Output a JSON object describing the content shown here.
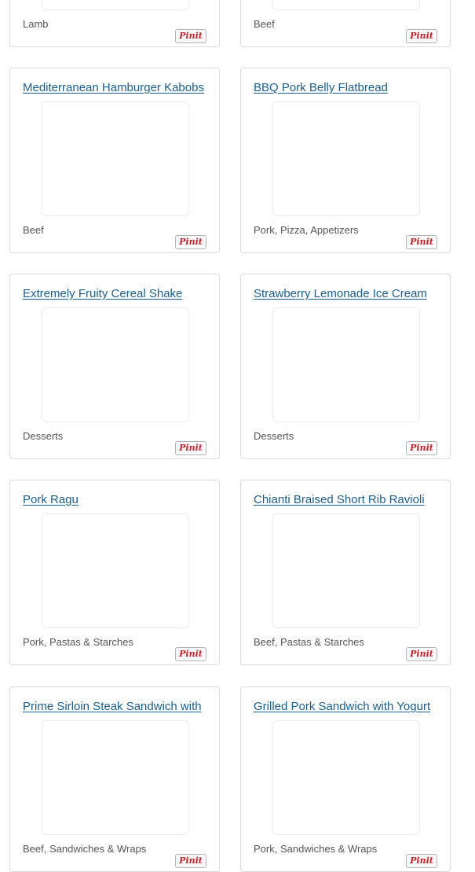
{
  "colors": {
    "title_link": "#1a5e8e",
    "category_text": "#555555",
    "pinit_red": "#cb2027",
    "card_border": "#dcdcdc"
  },
  "pin_label": "Pinit",
  "cards": [
    {
      "title": "",
      "category": "Lamb"
    },
    {
      "title": "",
      "category": "Beef"
    },
    {
      "title": "Mediterranean Hamburger Kabobs",
      "category": "Beef"
    },
    {
      "title": "BBQ Pork Belly Flatbread",
      "category": "Pork, Pizza, Appetizers"
    },
    {
      "title": "Extremely Fruity Cereal Shake",
      "category": "Desserts"
    },
    {
      "title": "Strawberry Lemonade Ice Cream",
      "category": "Desserts"
    },
    {
      "title": "Pork Ragu",
      "category": "Pork, Pastas & Starches"
    },
    {
      "title": "Chianti Braised Short Rib Ravioli",
      "category": "Beef, Pastas & Starches"
    },
    {
      "title": "Prime Sirloin Steak Sandwich with",
      "category": "Beef, Sandwiches & Wraps"
    },
    {
      "title": "Grilled Pork Sandwich with Yogurt",
      "category": "Pork, Sandwiches & Wraps"
    }
  ]
}
